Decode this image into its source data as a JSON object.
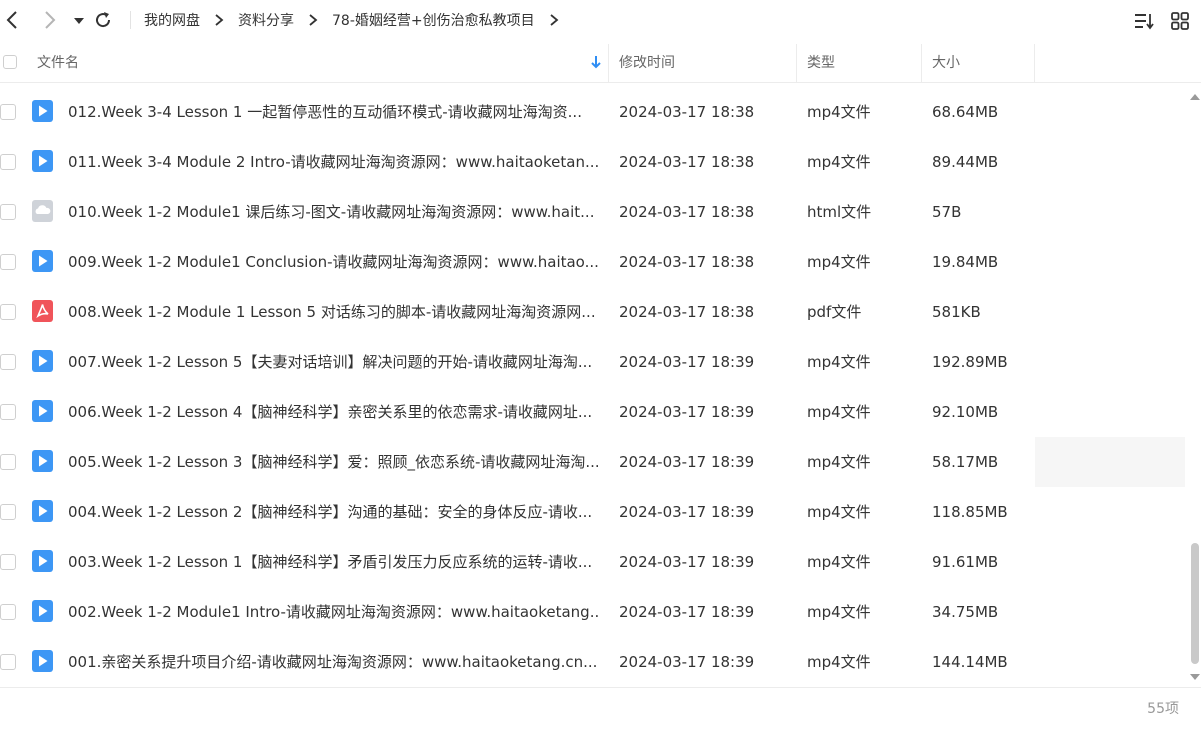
{
  "breadcrumb": [
    "我的网盘",
    "资料分享",
    "78-婚姻经营+创伤治愈私教项目"
  ],
  "columns": {
    "name": "文件名",
    "modified": "修改时间",
    "type": "类型",
    "size": "大小"
  },
  "files": [
    {
      "name": "012.Week 3-4  Lesson 1   一起暂停恶性的互动循环模式-请收藏网址海淘资...",
      "date": "2024-03-17 18:38",
      "type": "mp4文件",
      "size": "68.64MB",
      "icon": "video-file-icon"
    },
    {
      "name": "011.Week 3-4 Module 2 Intro-请收藏网址海淘资源网：www.haitaoketan...",
      "date": "2024-03-17 18:38",
      "type": "mp4文件",
      "size": "89.44MB",
      "icon": "video-file-icon"
    },
    {
      "name": "010.Week 1-2 Module1 课后练习-图文-请收藏网址海淘资源网：www.hait...",
      "date": "2024-03-17 18:38",
      "type": "html文件",
      "size": "57B",
      "icon": "html-file-icon"
    },
    {
      "name": "009.Week 1-2 Module1 Conclusion-请收藏网址海淘资源网：www.haitao...",
      "date": "2024-03-17 18:38",
      "type": "mp4文件",
      "size": "19.84MB",
      "icon": "video-file-icon"
    },
    {
      "name": "008.Week 1-2 Module 1 Lesson 5 对话练习的脚本-请收藏网址海淘资源网...",
      "date": "2024-03-17 18:38",
      "type": "pdf文件",
      "size": "581KB",
      "icon": "pdf-file-icon"
    },
    {
      "name": "007.Week 1-2  Lesson 5【夫妻对话培训】解决问题的开始-请收藏网址海淘...",
      "date": "2024-03-17 18:39",
      "type": "mp4文件",
      "size": "192.89MB",
      "icon": "video-file-icon"
    },
    {
      "name": "006.Week 1-2 Lesson 4【脑神经科学】亲密关系里的依恋需求-请收藏网址...",
      "date": "2024-03-17 18:39",
      "type": "mp4文件",
      "size": "92.10MB",
      "icon": "video-file-icon"
    },
    {
      "name": "005.Week 1-2 Lesson 3【脑神经科学】爱：照顾_依恋系统-请收藏网址海淘...",
      "date": "2024-03-17 18:39",
      "type": "mp4文件",
      "size": "58.17MB",
      "icon": "video-file-icon"
    },
    {
      "name": "004.Week 1-2 Lesson 2【脑神经科学】沟通的基础：安全的身体反应-请收...",
      "date": "2024-03-17 18:39",
      "type": "mp4文件",
      "size": "118.85MB",
      "icon": "video-file-icon"
    },
    {
      "name": "003.Week 1-2 Lesson 1【脑神经科学】矛盾引发压力反应系统的运转-请收...",
      "date": "2024-03-17 18:39",
      "type": "mp4文件",
      "size": "91.61MB",
      "icon": "video-file-icon"
    },
    {
      "name": "002.Week 1-2 Module1 Intro-请收藏网址海淘资源网：www.haitaoketang...",
      "date": "2024-03-17 18:39",
      "type": "mp4文件",
      "size": "34.75MB",
      "icon": "video-file-icon"
    },
    {
      "name": "001.亲密关系提升项目介绍-请收藏网址海淘资源网：www.haitaoketang.cn....",
      "date": "2024-03-17 18:39",
      "type": "mp4文件",
      "size": "144.14MB",
      "icon": "video-file-icon"
    }
  ],
  "footer": {
    "count": "55项"
  },
  "colors": {
    "accent": "#2f8ef4",
    "video": "#3d97f5",
    "pdf": "#f0545a",
    "html": "#cfd3d9",
    "text": "#333333"
  }
}
